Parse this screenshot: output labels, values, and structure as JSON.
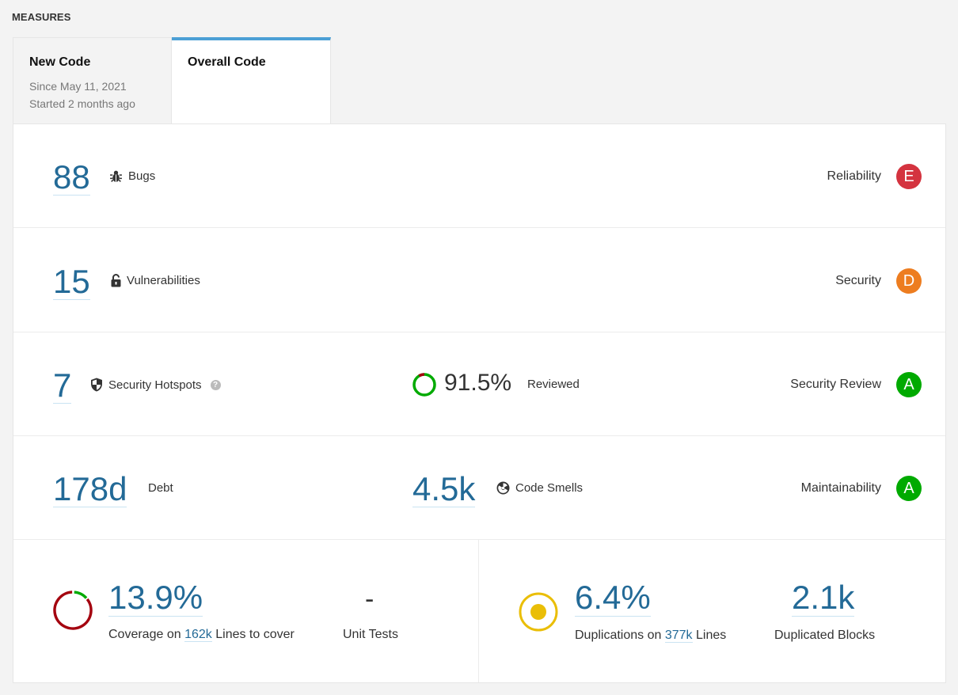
{
  "section_title": "MEASURES",
  "tabs": [
    {
      "title": "New Code",
      "subtitle_1": "Since May 11, 2021",
      "subtitle_2": "Started 2 months ago",
      "active": false
    },
    {
      "title": "Overall Code",
      "active": true
    }
  ],
  "accent_color": "#4b9fd5",
  "reliability": {
    "value": "88",
    "label": "Bugs",
    "icon": "bug-icon",
    "rating_label": "Reliability",
    "rating": "E",
    "rating_color": "#d4333f"
  },
  "security": {
    "value": "15",
    "label": "Vulnerabilities",
    "icon": "lock-icon",
    "rating_label": "Security",
    "rating": "D",
    "rating_color": "#ed7d20"
  },
  "security_review": {
    "value": "7",
    "label": "Security Hotspots",
    "icon": "shield-icon",
    "help_icon": "?",
    "reviewed_pct": "91.5%",
    "reviewed_fraction": 0.915,
    "reviewed_label": "Reviewed",
    "rating_label": "Security Review",
    "rating": "A",
    "rating_color": "#00aa00"
  },
  "maintainability": {
    "debt_value": "178d",
    "debt_label": "Debt",
    "smells_value": "4.5k",
    "smells_label": "Code Smells",
    "icon": "code-smell-icon",
    "rating_label": "Maintainability",
    "rating": "A",
    "rating_color": "#00aa00"
  },
  "coverage": {
    "value": "13.9%",
    "fraction": 0.139,
    "desc_prefix": "Coverage on",
    "lines": "162k",
    "desc_suffix": "Lines to cover",
    "unit_tests_value": "-",
    "unit_tests_label": "Unit Tests"
  },
  "duplications": {
    "value": "6.4%",
    "desc_prefix": "Duplications on",
    "lines": "377k",
    "desc_suffix": "Lines",
    "blocks_value": "2.1k",
    "blocks_label": "Duplicated Blocks"
  }
}
